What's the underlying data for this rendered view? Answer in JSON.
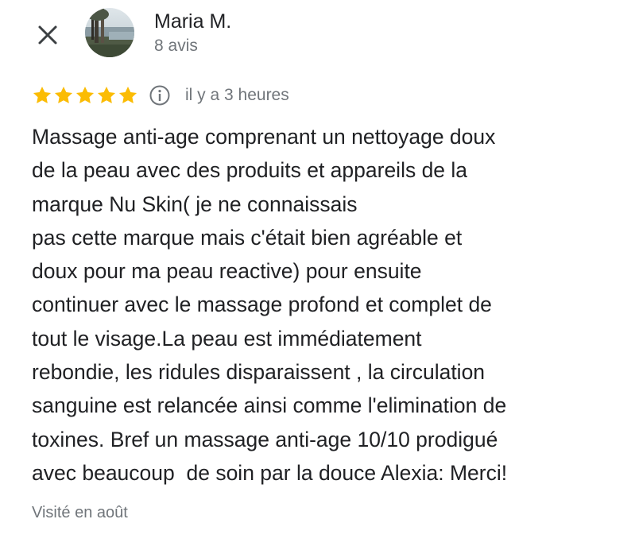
{
  "header": {
    "close_icon": "close-icon",
    "reviewer_name": "Maria M.",
    "review_count": "8 avis"
  },
  "review": {
    "rating": 5,
    "rating_max": 5,
    "star_color": "#fbbc04",
    "info_icon": "info-icon",
    "date": "il y a 3 heures",
    "lines": [
      "Massage anti-age comprenant un nettoyage doux",
      "de la peau avec des produits et appareils de la",
      "marque Nu Skin( je ne connaissais",
      "pas cette marque mais c'était bien agréable et",
      "doux pour ma peau reactive) pour ensuite",
      "continuer avec le massage profond et complet de",
      "tout le visage.La peau est immédiatement",
      "rebondie, les ridules disparaissent , la circulation",
      "sanguine est relancée ainsi comme l'elimination de",
      "toxines. Bref un massage anti-age 10/10 prodigué",
      "avec beaucoup  de soin par la douce Alexia: Merci!"
    ],
    "visit_info": "Visité en août"
  },
  "colors": {
    "primary_text": "#202124",
    "secondary_text": "#70757a",
    "star": "#fbbc04",
    "background": "#ffffff"
  }
}
